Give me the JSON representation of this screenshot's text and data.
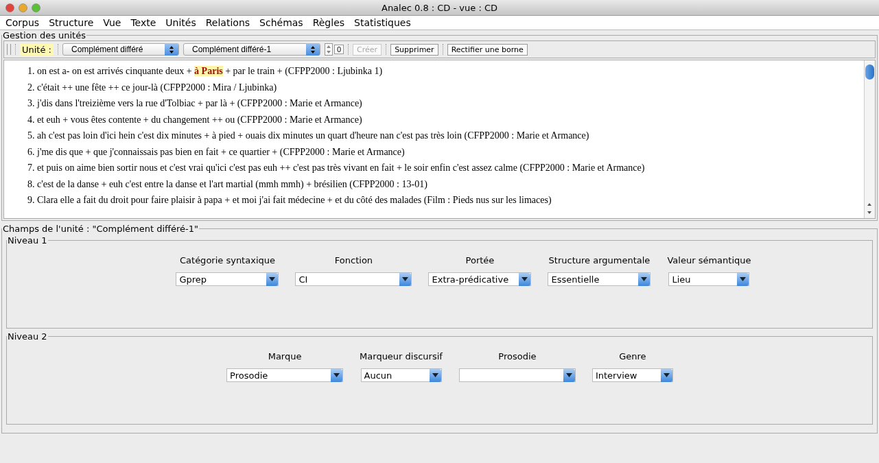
{
  "window": {
    "title": "Analec 0.8 : CD - vue : CD"
  },
  "menu": [
    "Corpus",
    "Structure",
    "Vue",
    "Texte",
    "Unités",
    "Relations",
    "Schémas",
    "Règles",
    "Statistiques"
  ],
  "units_panel": {
    "title": "Gestion des unités",
    "toolbar": {
      "label": "Unité :",
      "type_combo": "Complément différé",
      "unit_combo": "Complément différé-1",
      "spinner": "0",
      "buttons": [
        {
          "label": "Créer",
          "disabled": true
        },
        {
          "label": "Supprimer",
          "disabled": false
        },
        {
          "label": "Rectifier une borne",
          "disabled": false
        }
      ]
    },
    "lines": [
      {
        "number": "1.",
        "text": "on est a- on est arrivés cinquante deux + **à Paris** + par le train + (CFPP2000 : Ljubinka 1)"
      },
      {
        "number": "2.",
        "text": "c'était ++ une fête ++ ce jour-là (CFPP2000 : Mira / Ljubinka)"
      },
      {
        "number": "3.",
        "text": "j'dis dans l'treizième vers la rue d'Tolbiac + par là + (CFPP2000 : Marie et Armance)"
      },
      {
        "number": "4.",
        "text": "et euh + vous êtes contente + du changement ++ ou (CFPP2000 : Marie et Armance)"
      },
      {
        "number": "5.",
        "text": "ah c'est pas loin d'ici hein c'est dix minutes + à pied + ouais dix minutes un quart d'heure nan c'est pas très loin (CFPP2000 : Marie et Armance)"
      },
      {
        "number": "6.",
        "text": "j'me dis que + que j'connaissais pas bien en fait + ce quartier + (CFPP2000 : Marie et Armance)"
      },
      {
        "number": "7.",
        "text": "et puis on aime bien sortir nous et c'est vrai qu'ici c'est pas euh ++ c'est pas très vivant en fait + le soir enfin c'est assez calme (CFPP2000 : Marie et Armance)"
      },
      {
        "number": "8.",
        "text": "c'est de la danse + euh c'est entre la danse et l'art martial (mmh mmh) + brésilien (CFPP2000 : 13-01)"
      },
      {
        "number": "9.",
        "text": "Clara elle a fait du droit pour faire plaisir à papa + et moi j'ai fait médecine + et du côté des malades (Film : Pieds nus sur les limaces)"
      }
    ]
  },
  "fields_panel": {
    "title": "Champs de l'unité :  \"Complément différé-1\"",
    "levels": [
      {
        "title": "Niveau 1",
        "fields": [
          {
            "label": "Catégorie syntaxique",
            "value": "Gprep"
          },
          {
            "label": "Fonction",
            "value": "CI"
          },
          {
            "label": "Portée",
            "value": "Extra-prédicative"
          },
          {
            "label": "Structure argumentale",
            "value": "Essentielle"
          },
          {
            "label": "Valeur sémantique",
            "value": "Lieu"
          }
        ]
      },
      {
        "title": "Niveau 2",
        "fields": [
          {
            "label": "Marque",
            "value": "Prosodie"
          },
          {
            "label": "Marqueur discursif",
            "value": "Aucun"
          },
          {
            "label": "Prosodie"
          },
          {
            "label": "Genre",
            "value": "Interview"
          }
        ]
      }
    ]
  }
}
